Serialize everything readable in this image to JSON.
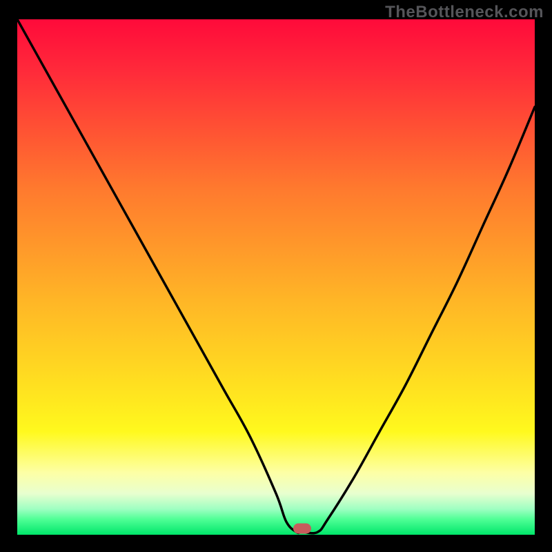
{
  "watermark": "TheBottleneck.com",
  "chart_data": {
    "type": "line",
    "title": "",
    "xlabel": "",
    "ylabel": "",
    "xlim": [
      0,
      100
    ],
    "ylim": [
      0,
      100
    ],
    "grid": false,
    "legend": false,
    "series": [
      {
        "name": "bottleneck-curve",
        "x": [
          0,
          5,
          10,
          15,
          20,
          25,
          30,
          35,
          40,
          45,
          50,
          52,
          54,
          55,
          58,
          60,
          65,
          70,
          75,
          80,
          85,
          90,
          95,
          100
        ],
        "values": [
          100,
          91,
          82,
          73,
          64,
          55,
          46,
          37,
          28,
          19,
          8,
          2.5,
          0.5,
          0.5,
          0.5,
          3,
          11,
          20,
          29,
          39,
          49,
          60,
          71,
          83
        ]
      }
    ],
    "marker": {
      "x": 55,
      "y": 1.2,
      "color": "#c75c5c"
    },
    "background_gradient": {
      "top": "#ff0a3a",
      "middle": "#ffe81f",
      "bottom": "#00e66a"
    }
  }
}
